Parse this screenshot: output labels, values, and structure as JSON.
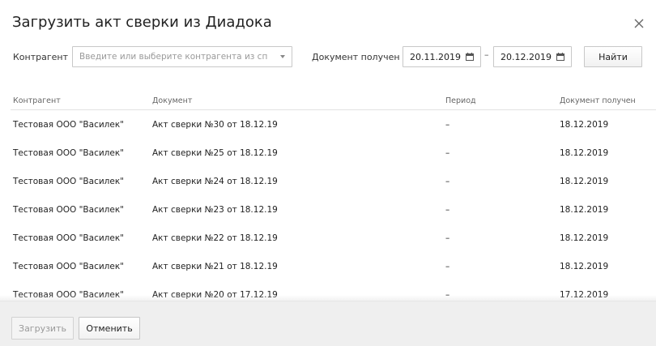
{
  "dialog": {
    "title": "Загрузить акт сверки из Диадока",
    "close_icon": "close-icon"
  },
  "filter": {
    "counterparty_label": "Контрагент",
    "counterparty_placeholder": "Введите или выберите контрагента из списка",
    "received_label": "Документ получен",
    "date_from": "20.11.2019",
    "date_separator": "–",
    "date_to": "20.12.2019",
    "calendar_icon": "calendar-icon",
    "find_label": "Найти"
  },
  "table": {
    "columns": [
      "Контрагент",
      "Документ",
      "Период",
      "Документ получен"
    ],
    "rows": [
      {
        "counterparty": "Тестовая ООО \"Василек\"",
        "document": "Акт сверки №30 от 18.12.19",
        "period": "–",
        "received": "18.12.2019"
      },
      {
        "counterparty": "Тестовая ООО \"Василек\"",
        "document": "Акт сверки №25 от 18.12.19",
        "period": "–",
        "received": "18.12.2019"
      },
      {
        "counterparty": "Тестовая ООО \"Василек\"",
        "document": "Акт сверки №24 от 18.12.19",
        "period": "–",
        "received": "18.12.2019"
      },
      {
        "counterparty": "Тестовая ООО \"Василек\"",
        "document": "Акт сверки №23 от 18.12.19",
        "period": "–",
        "received": "18.12.2019"
      },
      {
        "counterparty": "Тестовая ООО \"Василек\"",
        "document": "Акт сверки №22 от 18.12.19",
        "period": "–",
        "received": "18.12.2019"
      },
      {
        "counterparty": "Тестовая ООО \"Василек\"",
        "document": "Акт сверки №21 от 18.12.19",
        "period": "–",
        "received": "18.12.2019"
      },
      {
        "counterparty": "Тестовая ООО \"Василек\"",
        "document": "Акт сверки №20 от 17.12.19",
        "period": "–",
        "received": "17.12.2019"
      }
    ]
  },
  "footer": {
    "upload_label": "Загрузить",
    "cancel_label": "Отменить"
  }
}
